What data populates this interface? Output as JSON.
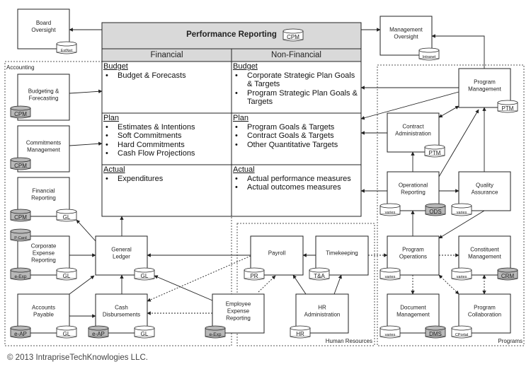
{
  "performance_reporting": {
    "title": "Performance Reporting",
    "db": "CPM",
    "columns": [
      "Financial",
      "Non-Financial"
    ],
    "financial": {
      "budget": {
        "heading": "Budget",
        "items": [
          "Budget & Forecasts"
        ]
      },
      "plan": {
        "heading": "Plan",
        "items": [
          "Estimates & Intentions",
          "Soft Commitments",
          "Hard Commitments",
          "Cash Flow Projections"
        ]
      },
      "actual": {
        "heading": "Actual",
        "items": [
          "Expenditures"
        ]
      }
    },
    "non_financial": {
      "budget": {
        "heading": "Budget",
        "items": [
          "Corporate Strategic Plan Goals & Targets",
          "Program Strategic Plan Goals & Targets"
        ]
      },
      "plan": {
        "heading": "Plan",
        "items": [
          "Program Goals & Targets",
          "Contract Goals & Targets",
          "Other Quantitative Targets"
        ]
      },
      "actual": {
        "heading": "Actual",
        "items": [
          "Actual performance measures",
          "Actual outcomes measures"
        ]
      }
    }
  },
  "groups": [
    "Accounting",
    "Human Resources",
    "Programs"
  ],
  "colors": {
    "db_shaded": "#b8b8b8",
    "header_gray": "#d9d9d9",
    "line": "#222222"
  },
  "nodes": [
    {
      "label": [
        "Board",
        "Oversight"
      ],
      "dbs": [
        {
          "name": "ExtNet",
          "shaded": false
        }
      ]
    },
    {
      "label": [
        "Management",
        "Oversight"
      ],
      "dbs": [
        {
          "name": "Intranet",
          "shaded": false
        }
      ]
    },
    {
      "label": [
        "Budgeting &",
        "Forecasting"
      ],
      "dbs": [
        {
          "name": "CPM",
          "shaded": true
        }
      ]
    },
    {
      "label": [
        "Commitments",
        "Management"
      ],
      "dbs": [
        {
          "name": "CPM",
          "shaded": true
        }
      ]
    },
    {
      "label": [
        "Financial",
        "Reporting"
      ],
      "dbs": [
        {
          "name": "CPM",
          "shaded": true
        },
        {
          "name": "GL",
          "shaded": false
        }
      ]
    },
    {
      "label": [
        "Corporate",
        "Expense",
        "Reporting"
      ],
      "dbs": [
        {
          "name": "P-Card",
          "shaded": true
        },
        {
          "name": "e-Exp",
          "shaded": true
        },
        {
          "name": "GL",
          "shaded": false
        }
      ]
    },
    {
      "label": [
        "Accounts",
        "Payable"
      ],
      "dbs": [
        {
          "name": "e-AP",
          "shaded": true
        },
        {
          "name": "GL",
          "shaded": false
        }
      ]
    },
    {
      "label": [
        "General",
        "Ledger"
      ],
      "dbs": [
        {
          "name": "GL",
          "shaded": false
        }
      ]
    },
    {
      "label": [
        "Cash",
        "Disbursements"
      ],
      "dbs": [
        {
          "name": "e-AP",
          "shaded": true
        },
        {
          "name": "GL",
          "shaded": false
        }
      ]
    },
    {
      "label": [
        "Employee",
        "Expense",
        "Reporting"
      ],
      "dbs": [
        {
          "name": "e-Exp",
          "shaded": true
        }
      ]
    },
    {
      "label": [
        "Payroll"
      ],
      "dbs": [
        {
          "name": "PR",
          "shaded": false
        }
      ]
    },
    {
      "label": [
        "Timekeeping"
      ],
      "dbs": [
        {
          "name": "T&A",
          "shaded": false
        }
      ]
    },
    {
      "label": [
        "HR",
        "Administration"
      ],
      "dbs": [
        {
          "name": "HR",
          "shaded": false
        }
      ]
    },
    {
      "label": [
        "Program",
        "Management"
      ],
      "dbs": [
        {
          "name": "PTM",
          "shaded": false
        }
      ]
    },
    {
      "label": [
        "Contract",
        "Administration"
      ],
      "dbs": [
        {
          "name": "PTM",
          "shaded": false
        }
      ]
    },
    {
      "label": [
        "Operational",
        "Reporting"
      ],
      "dbs": [
        {
          "name": "varies",
          "shaded": false
        },
        {
          "name": "ODS",
          "shaded": true
        }
      ]
    },
    {
      "label": [
        "Quality",
        "Assurance"
      ],
      "dbs": [
        {
          "name": "varies",
          "shaded": false
        }
      ]
    },
    {
      "label": [
        "Program",
        "Operations"
      ],
      "dbs": [
        {
          "name": "varies",
          "shaded": false
        }
      ]
    },
    {
      "label": [
        "Constituent",
        "Management"
      ],
      "dbs": [
        {
          "name": "varies",
          "shaded": false
        },
        {
          "name": "CRM",
          "shaded": true
        }
      ]
    },
    {
      "label": [
        "Document",
        "Management"
      ],
      "dbs": [
        {
          "name": "varies",
          "shaded": false
        },
        {
          "name": "DMS",
          "shaded": true
        }
      ]
    },
    {
      "label": [
        "Program",
        "Collaboration"
      ],
      "dbs": [
        {
          "name": "CPortal",
          "shaded": false
        }
      ]
    }
  ],
  "footer": {
    "copyright": "© 2013 IntrapriseTechKnowlogies LLC."
  }
}
